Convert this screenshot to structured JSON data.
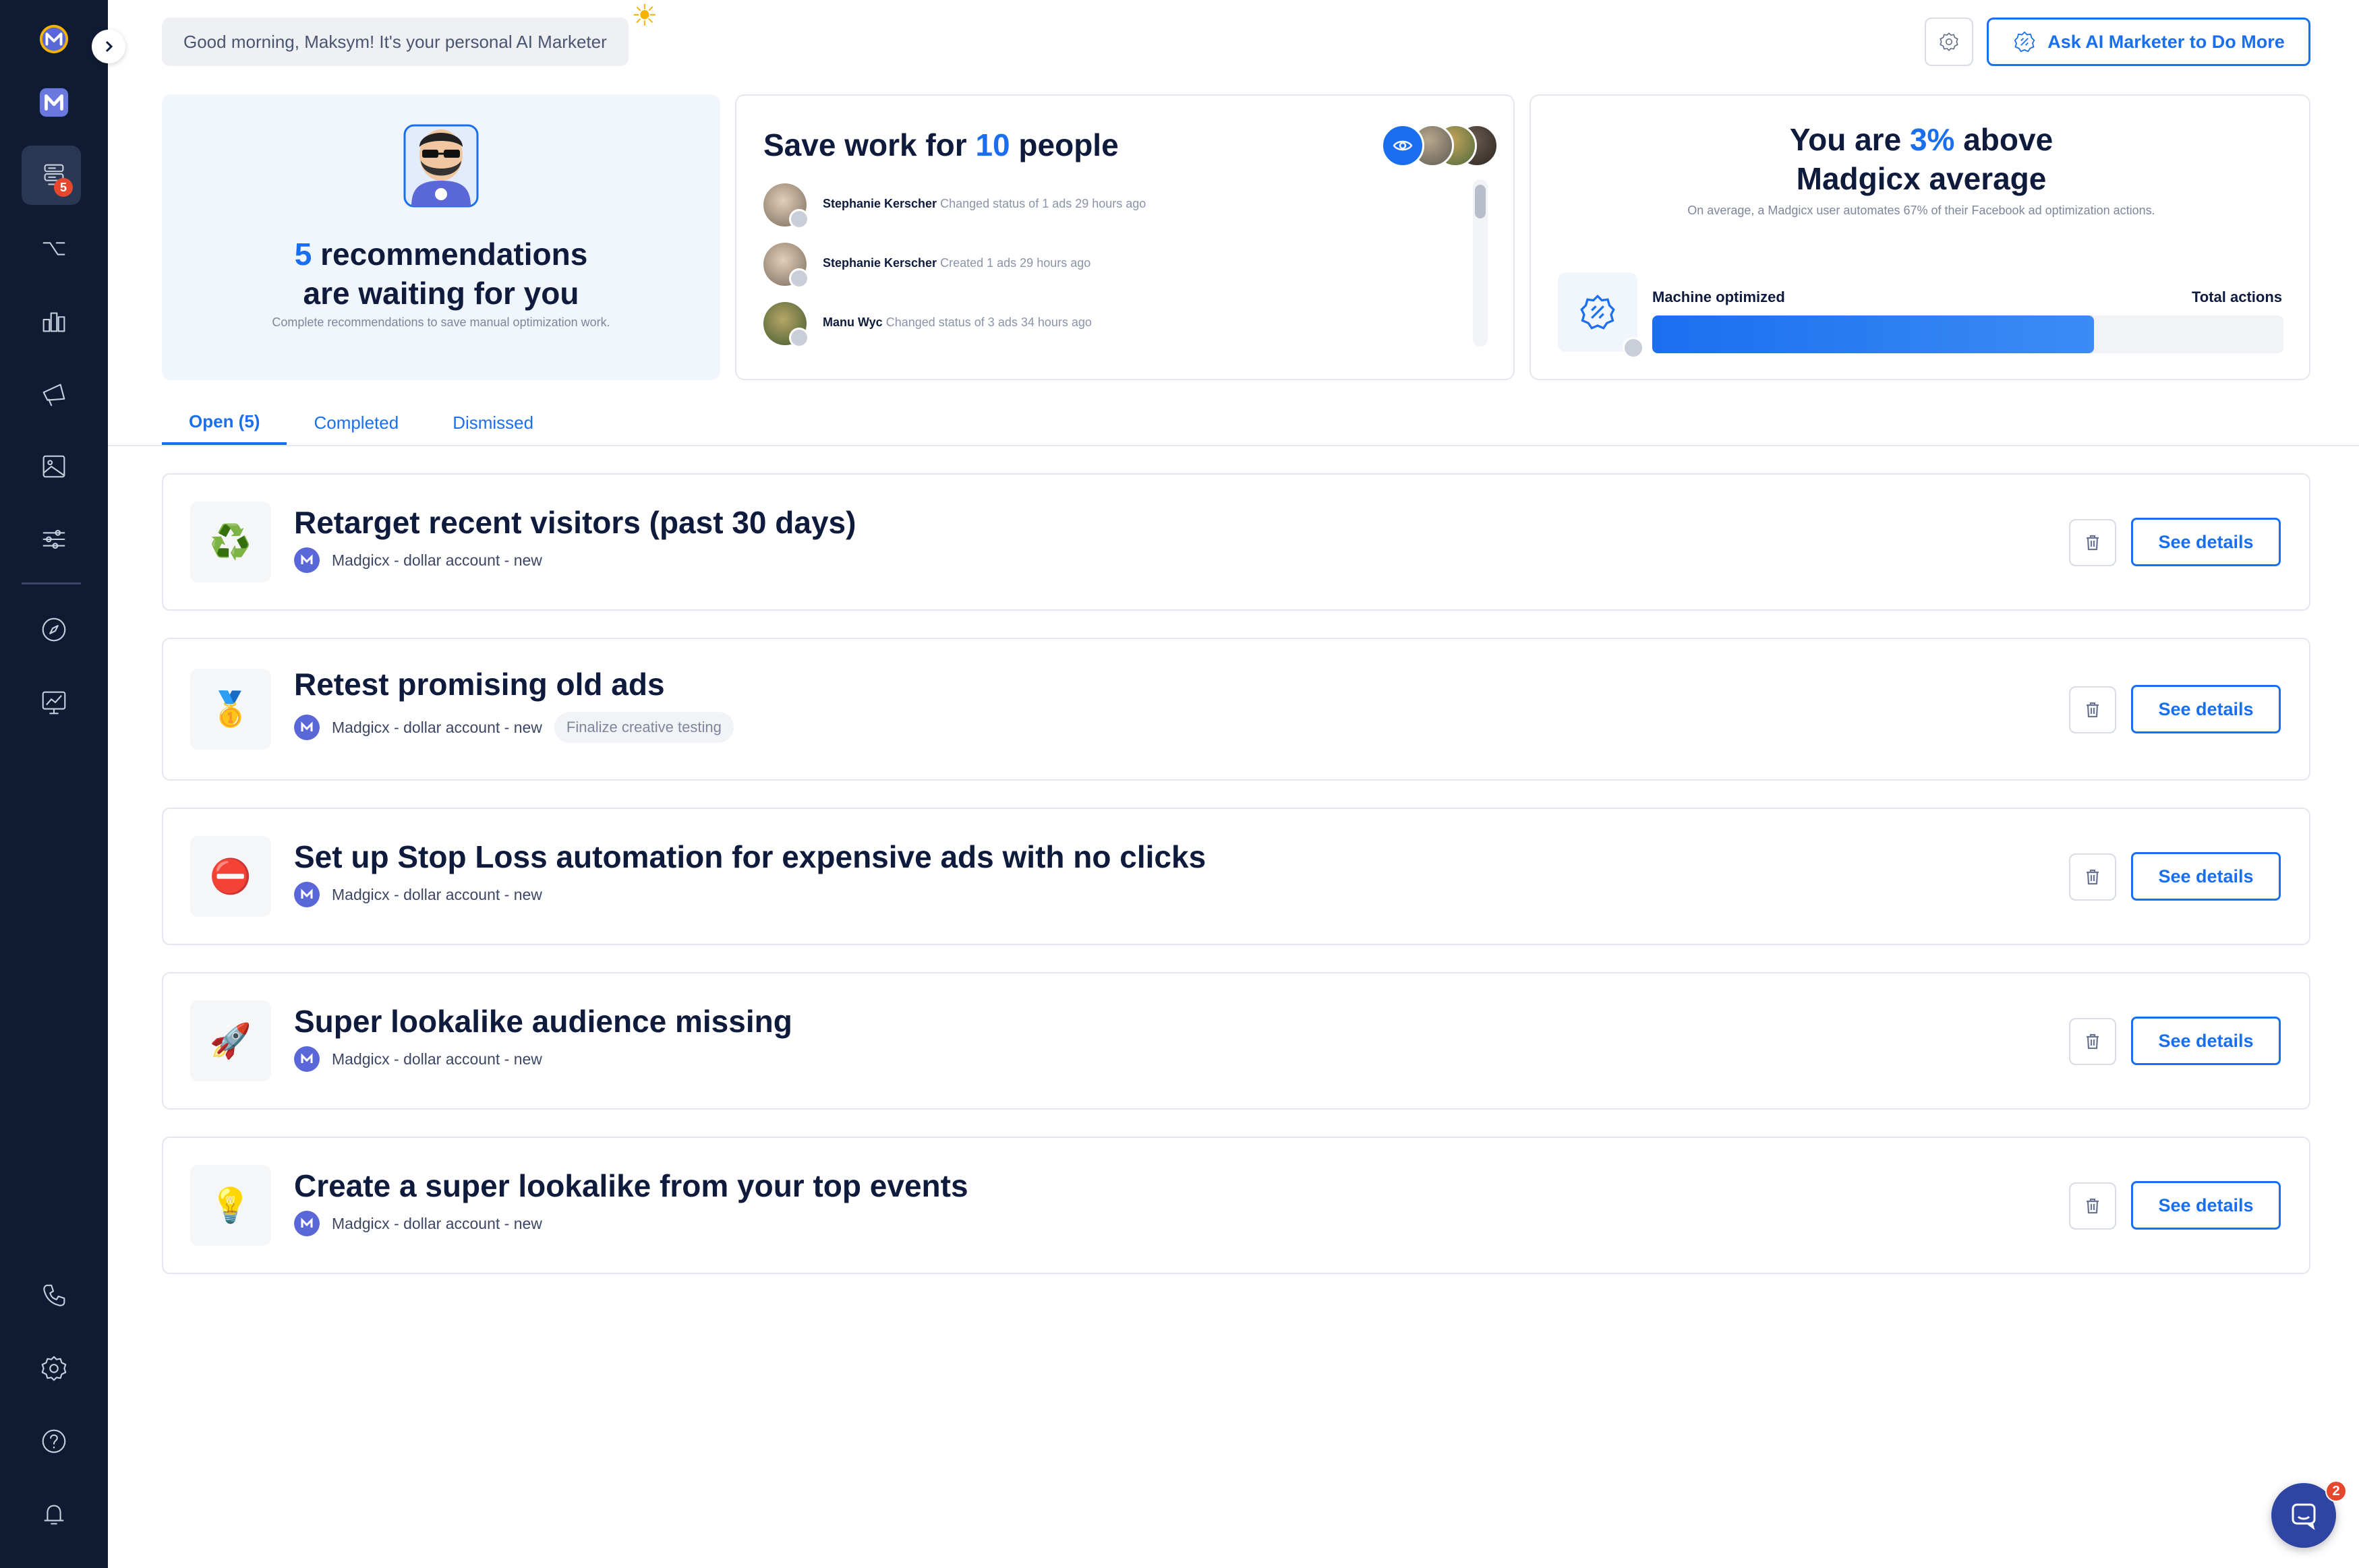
{
  "header": {
    "greeting": "Good morning, Maksym! It's your personal AI Marketer",
    "ask_button": "Ask AI Marketer to Do More"
  },
  "sidebar": {
    "recommendations_badge": "5",
    "items": [
      "logo",
      "madgicx-app",
      "recommendations",
      "automation",
      "analytics",
      "ad-launcher",
      "creative-library",
      "audience-studio",
      "explore",
      "reports",
      "contact",
      "settings",
      "help",
      "notifications"
    ]
  },
  "summary": {
    "recommendations": {
      "count": "5",
      "title_line1": "recommendations",
      "title_line2": "are waiting for you",
      "subtitle": "Complete recommendations to save manual optimization work."
    },
    "save_work": {
      "prefix": "Save work for",
      "count": "10",
      "suffix": "people",
      "activities": [
        {
          "name": "Stephanie Kerscher",
          "desc": "Changed status of 1 ads 29 hours ago"
        },
        {
          "name": "Stephanie Kerscher",
          "desc": "Created 1 ads 29 hours ago"
        },
        {
          "name": "Manu Wyc",
          "desc": "Changed status of 3 ads 34 hours ago"
        }
      ]
    },
    "benchmark": {
      "prefix": "You are",
      "percent": "3%",
      "suffix": "above",
      "line2": "Madgicx average",
      "subtitle": "On average, a Madgicx user automates 67% of their Facebook ad optimization actions.",
      "machine_label": "Machine optimized",
      "total_label": "Total actions",
      "machine_share": 0.7
    }
  },
  "tabs": [
    {
      "label": "Open (5)",
      "active": true
    },
    {
      "label": "Completed",
      "active": false
    },
    {
      "label": "Dismissed",
      "active": false
    }
  ],
  "recommendations": [
    {
      "icon": "recycle-icon",
      "emoji": "♻️",
      "title": "Retarget recent visitors (past 30 days)",
      "account": "Madgicx - dollar account - new",
      "tag": "",
      "button": "See details"
    },
    {
      "icon": "medal-icon",
      "emoji": "🥇",
      "title": "Retest promising old ads",
      "account": "Madgicx - dollar account - new",
      "tag": "Finalize creative testing",
      "button": "See details"
    },
    {
      "icon": "no-entry-icon",
      "emoji": "⛔",
      "title": "Set up Stop Loss automation for expensive ads with no clicks",
      "account": "Madgicx - dollar account - new",
      "tag": "",
      "button": "See details"
    },
    {
      "icon": "rocket-icon",
      "emoji": "🚀",
      "title": "Super lookalike audience missing",
      "account": "Madgicx - dollar account - new",
      "tag": "",
      "button": "See details"
    },
    {
      "icon": "lightbulb-icon",
      "emoji": "💡",
      "title": "Create a super lookalike from your top events",
      "account": "Madgicx - dollar account - new",
      "tag": "",
      "button": "See details"
    }
  ],
  "chat": {
    "badge": "2"
  },
  "colors": {
    "accent": "#1a6ff0",
    "sidebar": "#0f1b33",
    "badge": "#e5482f"
  }
}
